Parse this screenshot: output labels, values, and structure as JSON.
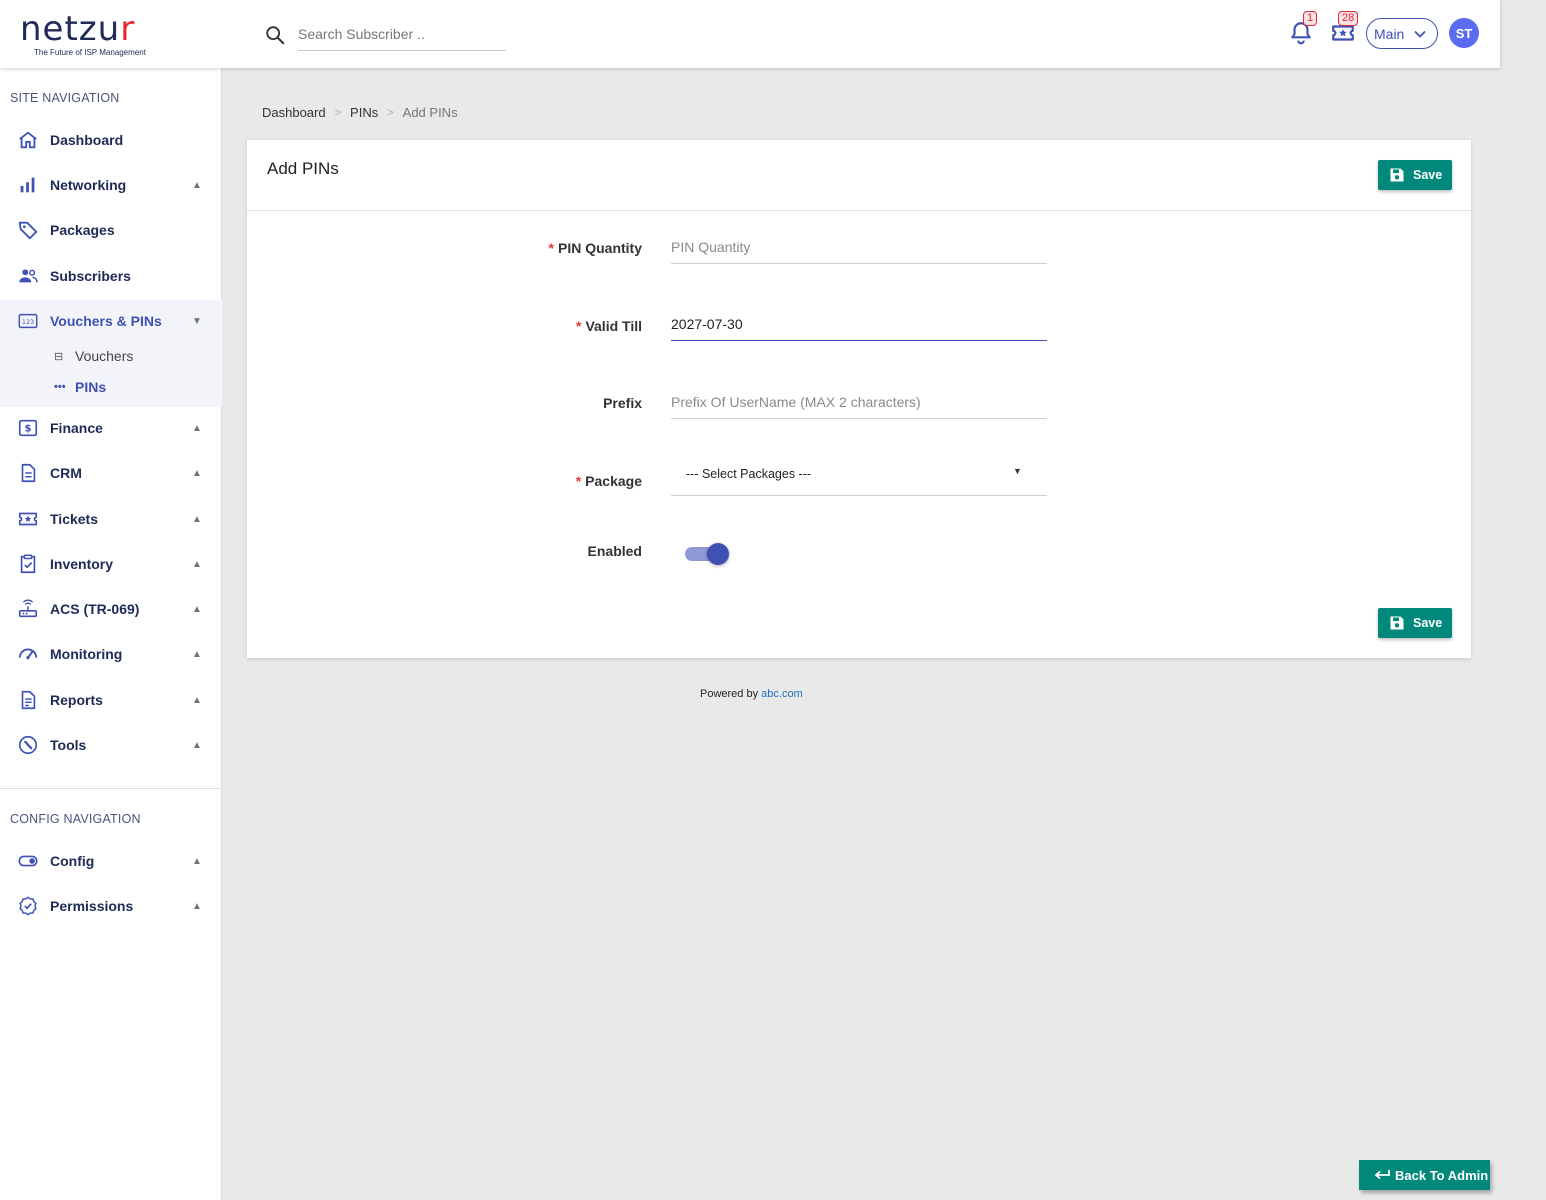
{
  "brand": {
    "name_main": "netzu",
    "name_accent": "r",
    "tagline": "The Future of ISP Management"
  },
  "search": {
    "placeholder": "Search Subscriber .."
  },
  "header": {
    "notifications_count": "1",
    "tickets_count": "28",
    "workspace": "Main",
    "user_initials": "ST"
  },
  "sidebar": {
    "site_heading": "SITE NAVIGATION",
    "items": [
      {
        "label": "Dashboard",
        "icon": "home-icon"
      },
      {
        "label": "Networking",
        "icon": "bar-chart-icon",
        "arrow": "▲"
      },
      {
        "label": "Packages",
        "icon": "tag-icon"
      },
      {
        "label": "Subscribers",
        "icon": "users-icon"
      },
      {
        "label": "Vouchers & PINs",
        "icon": "numeric-icon",
        "arrow": "▼"
      },
      {
        "label": "Finance",
        "icon": "dollar-icon",
        "arrow": "▲"
      },
      {
        "label": "CRM",
        "icon": "document-icon",
        "arrow": "▲"
      },
      {
        "label": "Tickets",
        "icon": "ticket-icon",
        "arrow": "▲"
      },
      {
        "label": "Inventory",
        "icon": "clipboard-check-icon",
        "arrow": "▲"
      },
      {
        "label": "ACS (TR-069)",
        "icon": "router-icon",
        "arrow": "▲"
      },
      {
        "label": "Monitoring",
        "icon": "speedometer-icon",
        "arrow": "▲"
      },
      {
        "label": "Reports",
        "icon": "report-icon",
        "arrow": "▲"
      },
      {
        "label": "Tools",
        "icon": "wrench-icon",
        "arrow": "▲"
      }
    ],
    "sub_items": [
      {
        "label": "Vouchers",
        "icon": "⊟"
      },
      {
        "label": "PINs",
        "icon": "•••"
      }
    ],
    "config_heading": "CONFIG NAVIGATION",
    "config_items": [
      {
        "label": "Config",
        "icon": "toggle-icon",
        "arrow": "▲"
      },
      {
        "label": "Permissions",
        "icon": "badge-check-icon",
        "arrow": "▲"
      }
    ]
  },
  "breadcrumb": {
    "items": [
      "Dashboard",
      "PINs",
      "Add PINs"
    ],
    "divider": ">"
  },
  "form": {
    "title": "Add PINs",
    "save_label": "Save",
    "pin_quantity": {
      "label": "PIN Quantity",
      "required": "*",
      "placeholder": "PIN Quantity",
      "value": ""
    },
    "valid_till": {
      "label": "Valid Till",
      "required": "*",
      "value": "2027-07-30"
    },
    "prefix": {
      "label": "Prefix",
      "placeholder": "Prefix Of UserName (MAX 2 characters)",
      "value": ""
    },
    "package": {
      "label": "Package",
      "required": "*",
      "selected": "--- Select Packages ---"
    },
    "enabled": {
      "label": "Enabled",
      "value": true
    }
  },
  "footer": {
    "powered_text": "Powered by",
    "powered_link": "abc.com"
  },
  "back_button": {
    "label": "Back To Admin"
  },
  "colors": {
    "primary": "#3f51b5",
    "success": "#00897b",
    "danger": "#e53935",
    "nav_text": "#1f2a56"
  }
}
